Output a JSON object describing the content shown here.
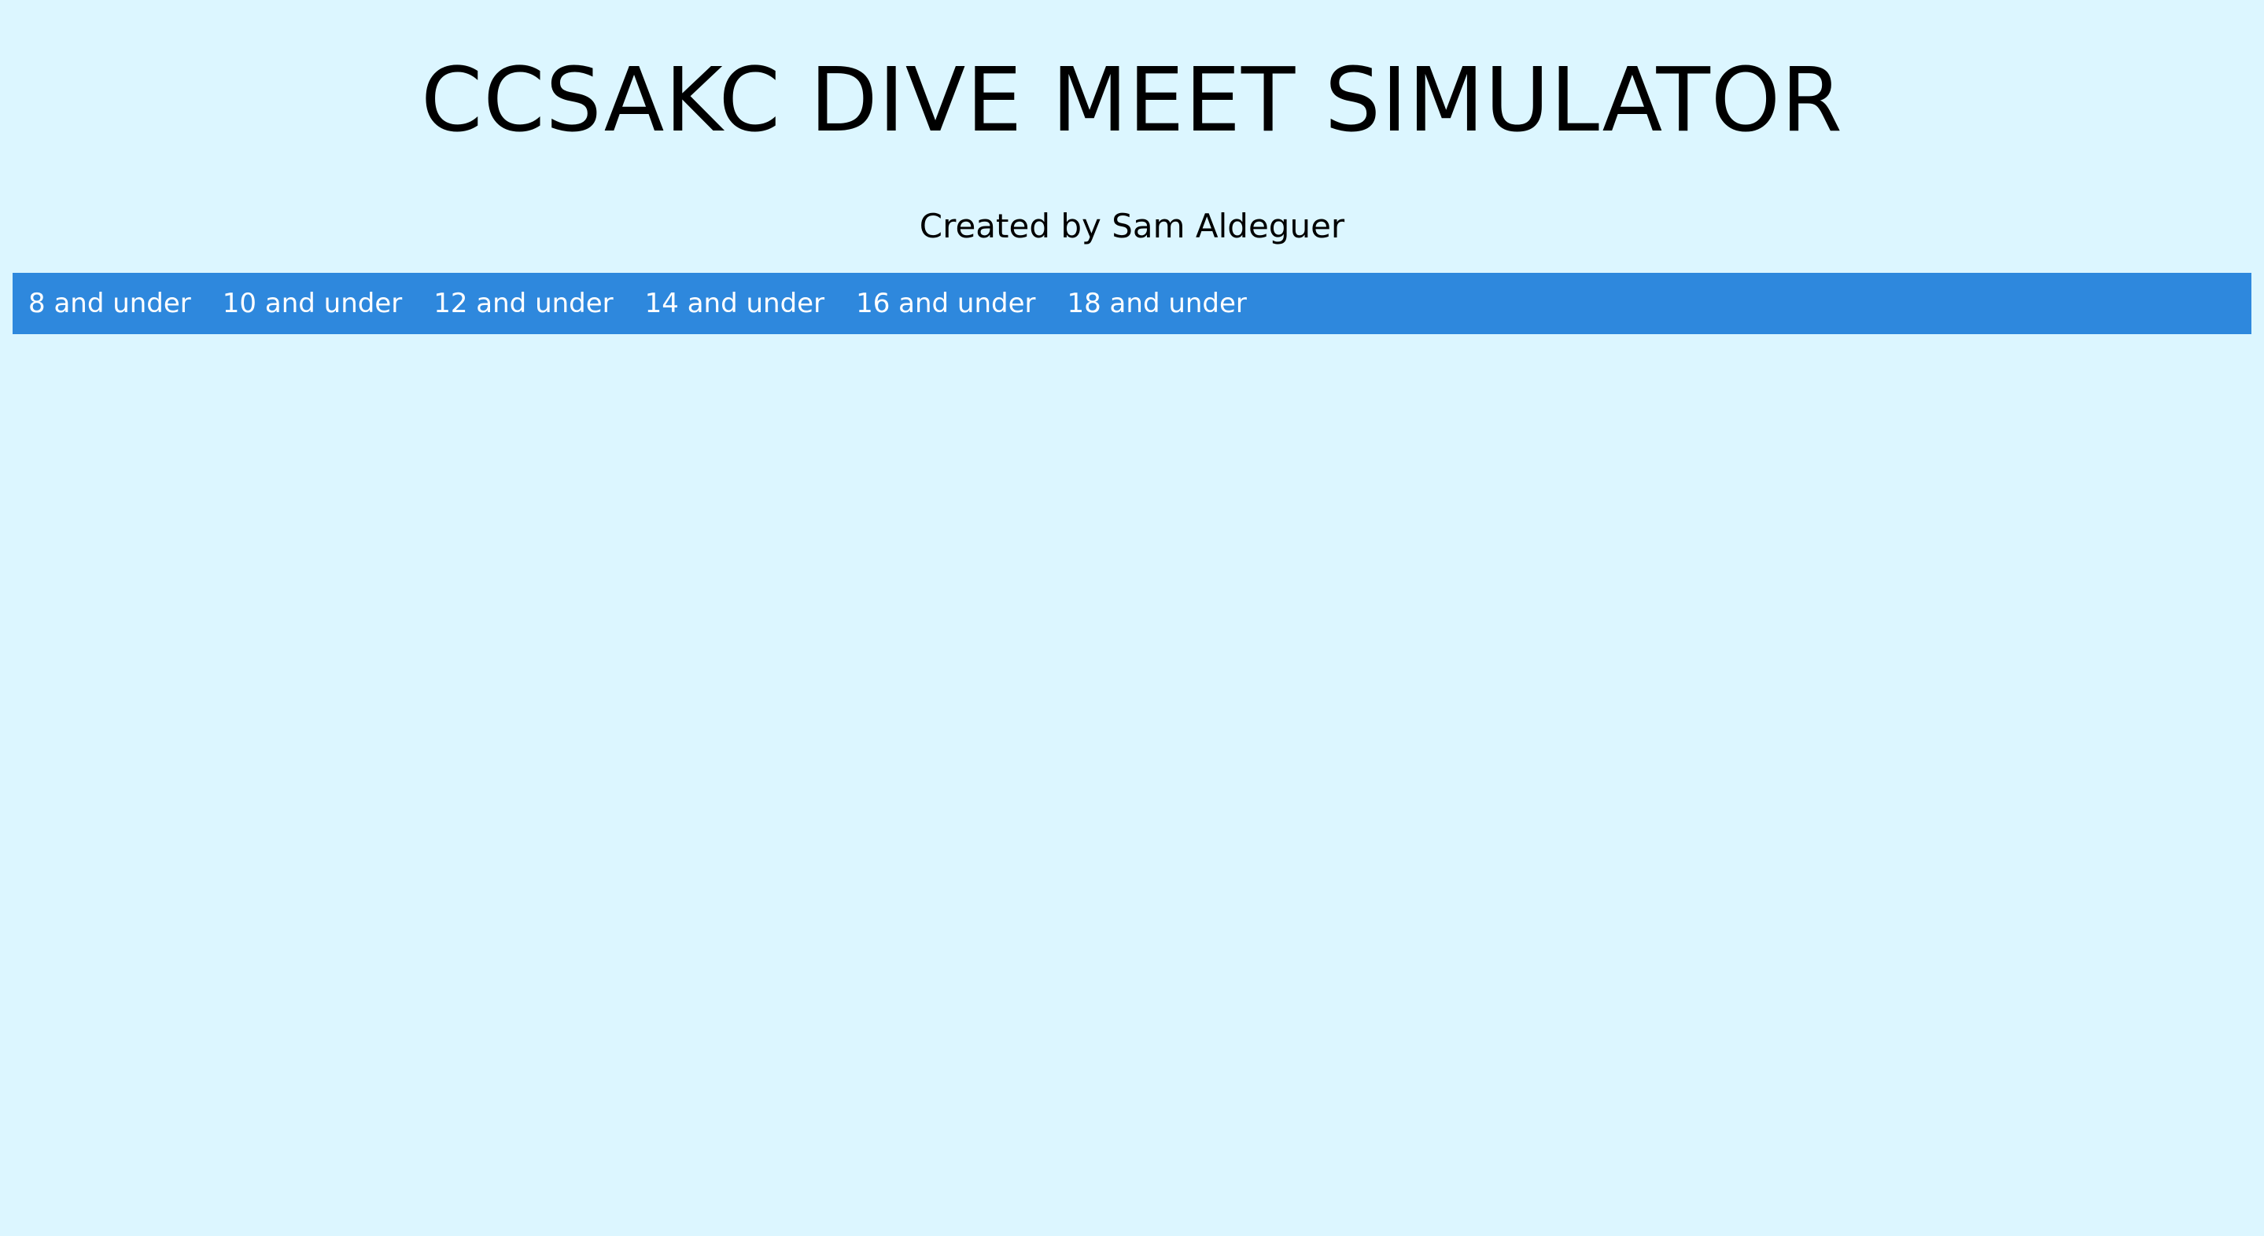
{
  "header": {
    "title": "CCSAKC DIVE MEET SIMULATOR",
    "subtitle": "Created by Sam Aldeguer"
  },
  "nav": {
    "items": [
      {
        "label": "8 and under"
      },
      {
        "label": "10 and under"
      },
      {
        "label": "12 and under"
      },
      {
        "label": "14 and under"
      },
      {
        "label": "16 and under"
      },
      {
        "label": "18 and under"
      }
    ]
  },
  "colors": {
    "background": "#dcf6ff",
    "nav_bar": "#2e88dd",
    "nav_text": "#ffffff",
    "heading_text": "#000000"
  }
}
